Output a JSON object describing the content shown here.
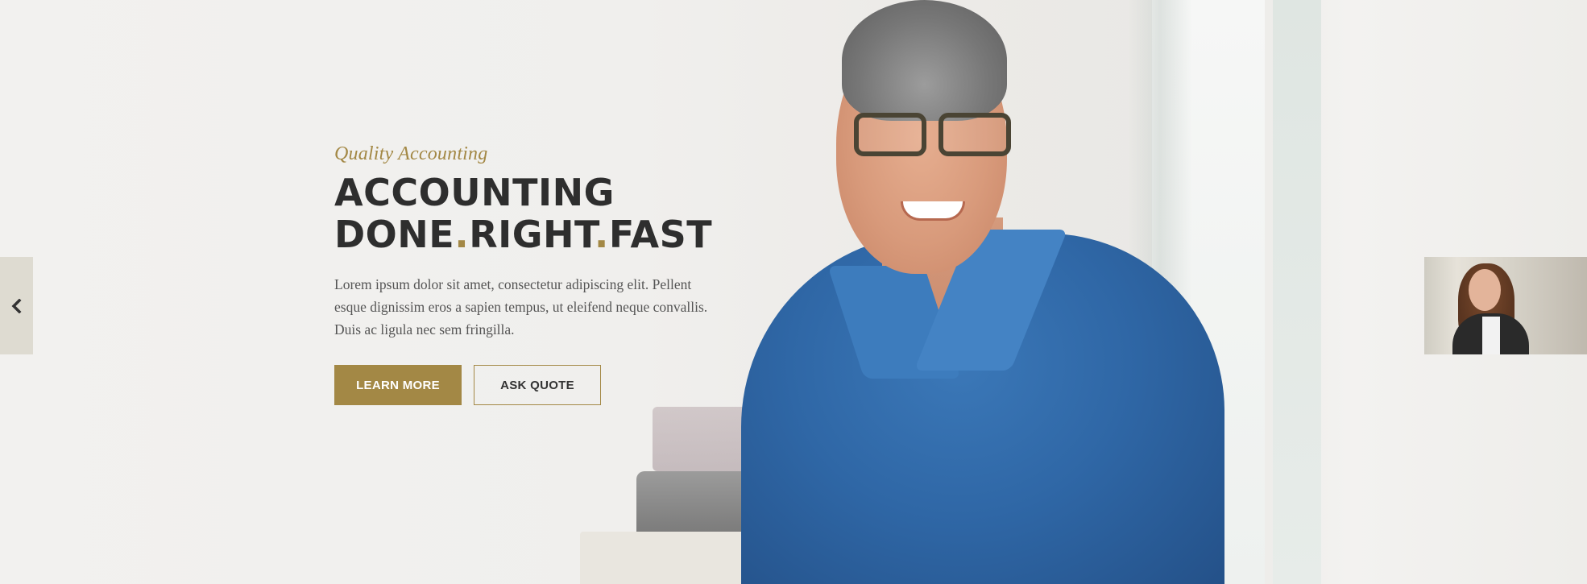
{
  "hero": {
    "eyebrow": "Quality Accounting",
    "headline": {
      "line1": "ACCOUNTING",
      "word1": "DONE",
      "sep1": ".",
      "word2": "RIGHT",
      "sep2": ".",
      "word3": "FAST"
    },
    "body": "Lorem ipsum dolor sit amet, consectetur adipiscing elit. Pellent esque dignissim eros a sapien tempus, ut eleifend neque convallis. Duis ac ligula nec sem fringilla.",
    "buttons": {
      "learn_more": "LEARN MORE",
      "ask_quote": "ASK QUOTE"
    }
  },
  "slider": {
    "prev_icon": "chevron-left-icon",
    "next_thumbnail": "next-slide-thumbnail"
  },
  "colors": {
    "accent": "#a38845",
    "headline": "#2e2e2e",
    "body": "#555555",
    "background": "#efeeec"
  }
}
